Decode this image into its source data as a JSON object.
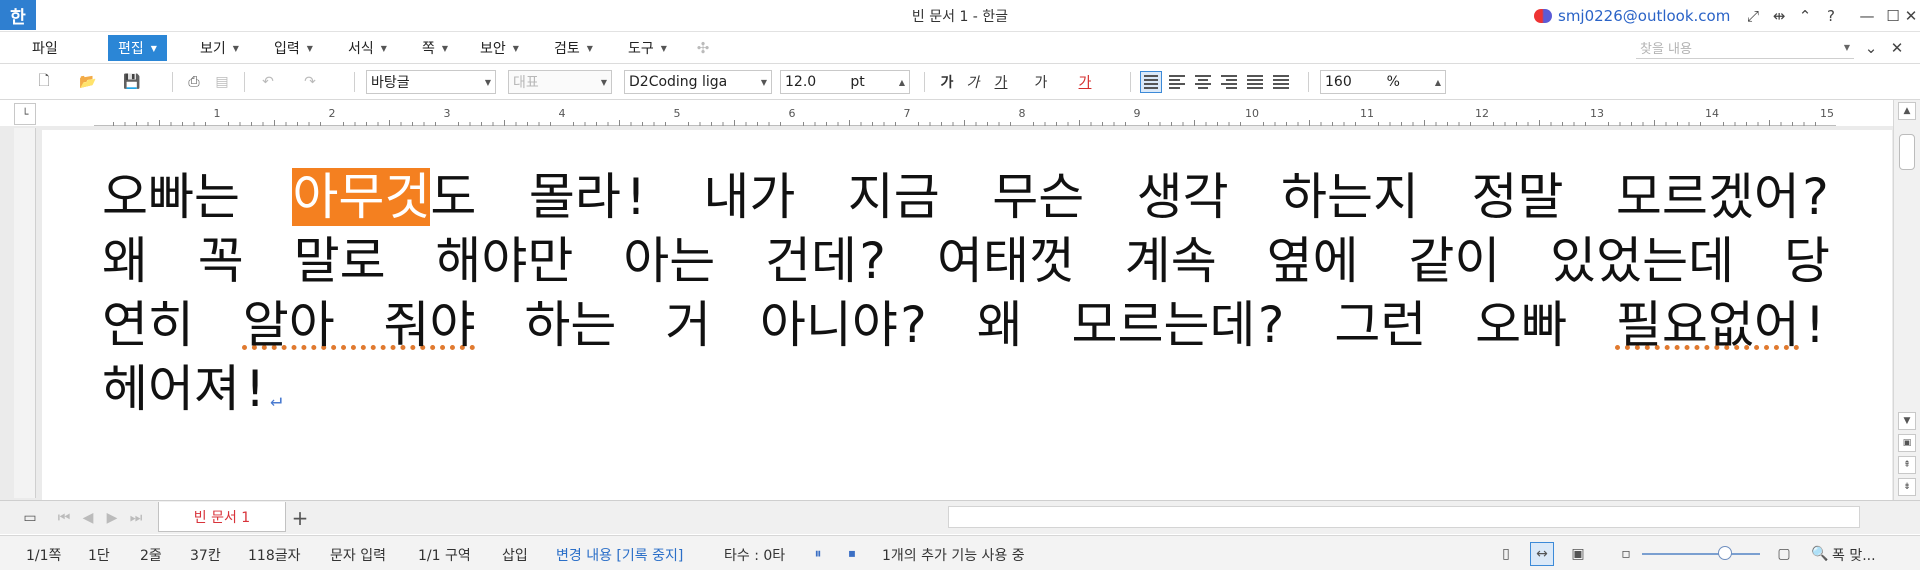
{
  "window": {
    "title": "빈 문서 1 - 한글",
    "app_icon": "한",
    "account": "smj0226@outlook.com"
  },
  "menu": {
    "file": "파일",
    "items": [
      "편집",
      "보기",
      "입력",
      "서식",
      "쪽",
      "보안",
      "검토",
      "도구"
    ],
    "search_placeholder": "찾을 내용"
  },
  "toolbar": {
    "style": "바탕글",
    "outline": "대표",
    "font": "D2Coding liga",
    "size": "12.0",
    "size_unit": "pt",
    "format_labels": [
      "가",
      "가",
      "가",
      "가",
      "가"
    ],
    "zoom": "160",
    "zoom_unit": "%"
  },
  "ruler": {
    "marks": [
      "1",
      "2",
      "3",
      "4",
      "5",
      "6",
      "7",
      "8",
      "9",
      "10",
      "11",
      "12",
      "13",
      "14",
      "15"
    ]
  },
  "document": {
    "before": "오빠는 ",
    "highlight": "아무것",
    "after": "도 몰라! 내가 지금 무슨 생각 하는지 정말 모르겠어? 왜 꼭 말로 해야만 아는 건데? 여태껏 계속 옆에 같이 있었는데 당연히 ",
    "squiggle1": "알아 줘야",
    "middle": " 하는 거 아니야? 왜 모르는데? 그런 오빠 ",
    "squiggle2": "필요없어",
    "end": "! 헤어져!",
    "para_mark": "↵"
  },
  "tabs": {
    "active": "빈 문서 1",
    "add": "+"
  },
  "status": {
    "page": "1/1쪽",
    "column": "1단",
    "line": "2줄",
    "col": "37칸",
    "chars": "118글자",
    "mode": "문자 입력",
    "section": "1/1 구역",
    "insert": "삽입",
    "track": "변경 내용 [기록 중지]",
    "typing": "타수 : 0타",
    "addon": "1개의 추가 기능 사용 중",
    "fit": "폭 맞..."
  },
  "colors": {
    "accent": "#2b86d6",
    "highlight": "#f48020",
    "tab_text": "#d8333a"
  }
}
